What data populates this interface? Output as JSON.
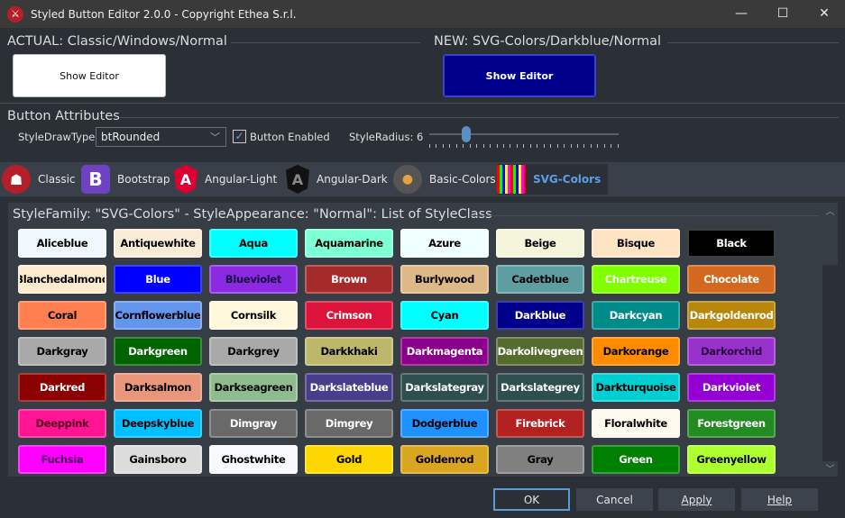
{
  "window": {
    "title": "Styled Button Editor 2.0.0 - Copyright Ethea S.r.l.",
    "minimize": "—",
    "maximize": "☐",
    "close": "✕"
  },
  "actual": {
    "title": "ACTUAL: Classic/Windows/Normal",
    "button": "Show Editor"
  },
  "new": {
    "title": "NEW: SVG-Colors/Darkblue/Normal",
    "button": "Show Editor"
  },
  "attributes": {
    "title": "Button Attributes",
    "draw_type_label": "StyleDrawType:",
    "draw_type_value": "btRounded",
    "enabled_label": "Button Enabled",
    "enabled_checked": true,
    "radius_label": "StyleRadius: 6",
    "radius_value": 6
  },
  "tabs": [
    {
      "label": "Classic",
      "icon": "spartan-helmet-icon"
    },
    {
      "label": "Bootstrap",
      "icon": "bootstrap-icon"
    },
    {
      "label": "Angular-Light",
      "icon": "angular-icon"
    },
    {
      "label": "Angular-Dark",
      "icon": "angular-dark-icon"
    },
    {
      "label": "Basic-Colors",
      "icon": "palette-icon"
    },
    {
      "label": "SVG-Colors",
      "icon": "color-grid-icon",
      "active": true
    }
  ],
  "panel": {
    "title": "StyleFamily: \"SVG-Colors\" - StyleAppearance: \"Normal\": List of StyleClass"
  },
  "buttons": [
    {
      "label": "Aliceblue",
      "bg": "#f0f8ff",
      "fg": "#000"
    },
    {
      "label": "Antiquewhite",
      "bg": "#faebd7",
      "fg": "#000"
    },
    {
      "label": "Aqua",
      "bg": "#00ffff",
      "fg": "#000"
    },
    {
      "label": "Aquamarine",
      "bg": "#7fffd4",
      "fg": "#000"
    },
    {
      "label": "Azure",
      "bg": "#f0ffff",
      "fg": "#000"
    },
    {
      "label": "Beige",
      "bg": "#f5f5dc",
      "fg": "#000"
    },
    {
      "label": "Bisque",
      "bg": "#ffe4c4",
      "fg": "#000"
    },
    {
      "label": "Black",
      "bg": "#000000",
      "fg": "#fff"
    },
    {
      "label": "Blanchedalmond",
      "bg": "#ffebcd",
      "fg": "#000"
    },
    {
      "label": "Blue",
      "bg": "#0000ff",
      "fg": "#fff"
    },
    {
      "label": "Blueviolet",
      "bg": "#8a2be2",
      "fg": "#1a0a40"
    },
    {
      "label": "Brown",
      "bg": "#a52a2a",
      "fg": "#fff"
    },
    {
      "label": "Burlywood",
      "bg": "#deb887",
      "fg": "#000"
    },
    {
      "label": "Cadetblue",
      "bg": "#5f9ea0",
      "fg": "#000"
    },
    {
      "label": "Chartreuse",
      "bg": "#7fff00",
      "fg": "#f0f0f0"
    },
    {
      "label": "Chocolate",
      "bg": "#d2691e",
      "fg": "#fff"
    },
    {
      "label": "Coral",
      "bg": "#ff7f50",
      "fg": "#000"
    },
    {
      "label": "Cornflowerblue",
      "bg": "#6495ed",
      "fg": "#000"
    },
    {
      "label": "Cornsilk",
      "bg": "#fff8dc",
      "fg": "#000"
    },
    {
      "label": "Crimson",
      "bg": "#dc143c",
      "fg": "#fff"
    },
    {
      "label": "Cyan",
      "bg": "#00ffff",
      "fg": "#000"
    },
    {
      "label": "Darkblue",
      "bg": "#00008b",
      "fg": "#fff"
    },
    {
      "label": "Darkcyan",
      "bg": "#008b8b",
      "fg": "#fff"
    },
    {
      "label": "Darkgoldenrod",
      "bg": "#b8860b",
      "fg": "#fff"
    },
    {
      "label": "Darkgray",
      "bg": "#a9a9a9",
      "fg": "#000"
    },
    {
      "label": "Darkgreen",
      "bg": "#006400",
      "fg": "#fff"
    },
    {
      "label": "Darkgrey",
      "bg": "#a9a9a9",
      "fg": "#000"
    },
    {
      "label": "Darkkhaki",
      "bg": "#bdb76b",
      "fg": "#000"
    },
    {
      "label": "Darkmagenta",
      "bg": "#8b008b",
      "fg": "#fff"
    },
    {
      "label": "Darkolivegreen",
      "bg": "#556b2f",
      "fg": "#fff"
    },
    {
      "label": "Darkorange",
      "bg": "#ff8c00",
      "fg": "#000"
    },
    {
      "label": "Darkorchid",
      "bg": "#9932cc",
      "fg": "#2a0a40"
    },
    {
      "label": "Darkred",
      "bg": "#8b0000",
      "fg": "#fff"
    },
    {
      "label": "Darksalmon",
      "bg": "#e9967a",
      "fg": "#000"
    },
    {
      "label": "Darkseagreen",
      "bg": "#8fbc8f",
      "fg": "#000"
    },
    {
      "label": "Darkslateblue",
      "bg": "#483d8b",
      "fg": "#fff"
    },
    {
      "label": "Darkslategray",
      "bg": "#2f4f4f",
      "fg": "#fff"
    },
    {
      "label": "Darkslategrey",
      "bg": "#2f4f4f",
      "fg": "#fff"
    },
    {
      "label": "Darkturquoise",
      "bg": "#00ced1",
      "fg": "#000"
    },
    {
      "label": "Darkviolet",
      "bg": "#9400d3",
      "fg": "#fff"
    },
    {
      "label": "Deeppink",
      "bg": "#ff1493",
      "fg": "#5a0020"
    },
    {
      "label": "Deepskyblue",
      "bg": "#00bfff",
      "fg": "#000"
    },
    {
      "label": "Dimgray",
      "bg": "#696969",
      "fg": "#fff"
    },
    {
      "label": "Dimgrey",
      "bg": "#696969",
      "fg": "#fff"
    },
    {
      "label": "Dodgerblue",
      "bg": "#1e90ff",
      "fg": "#000"
    },
    {
      "label": "Firebrick",
      "bg": "#b22222",
      "fg": "#fff"
    },
    {
      "label": "Floralwhite",
      "bg": "#fffaf0",
      "fg": "#000"
    },
    {
      "label": "Forestgreen",
      "bg": "#228b22",
      "fg": "#fff"
    },
    {
      "label": "Fuchsia",
      "bg": "#ff00ff",
      "fg": "#500060"
    },
    {
      "label": "Gainsboro",
      "bg": "#dcdcdc",
      "fg": "#000"
    },
    {
      "label": "Ghostwhite",
      "bg": "#f8f8ff",
      "fg": "#000"
    },
    {
      "label": "Gold",
      "bg": "#ffd700",
      "fg": "#000"
    },
    {
      "label": "Goldenrod",
      "bg": "#daa520",
      "fg": "#000"
    },
    {
      "label": "Gray",
      "bg": "#808080",
      "fg": "#000"
    },
    {
      "label": "Green",
      "bg": "#008000",
      "fg": "#fff"
    },
    {
      "label": "Greenyellow",
      "bg": "#adff2f",
      "fg": "#000"
    }
  ],
  "footer": {
    "ok": "OK",
    "cancel": "Cancel",
    "apply": "Apply",
    "help": "Help"
  }
}
